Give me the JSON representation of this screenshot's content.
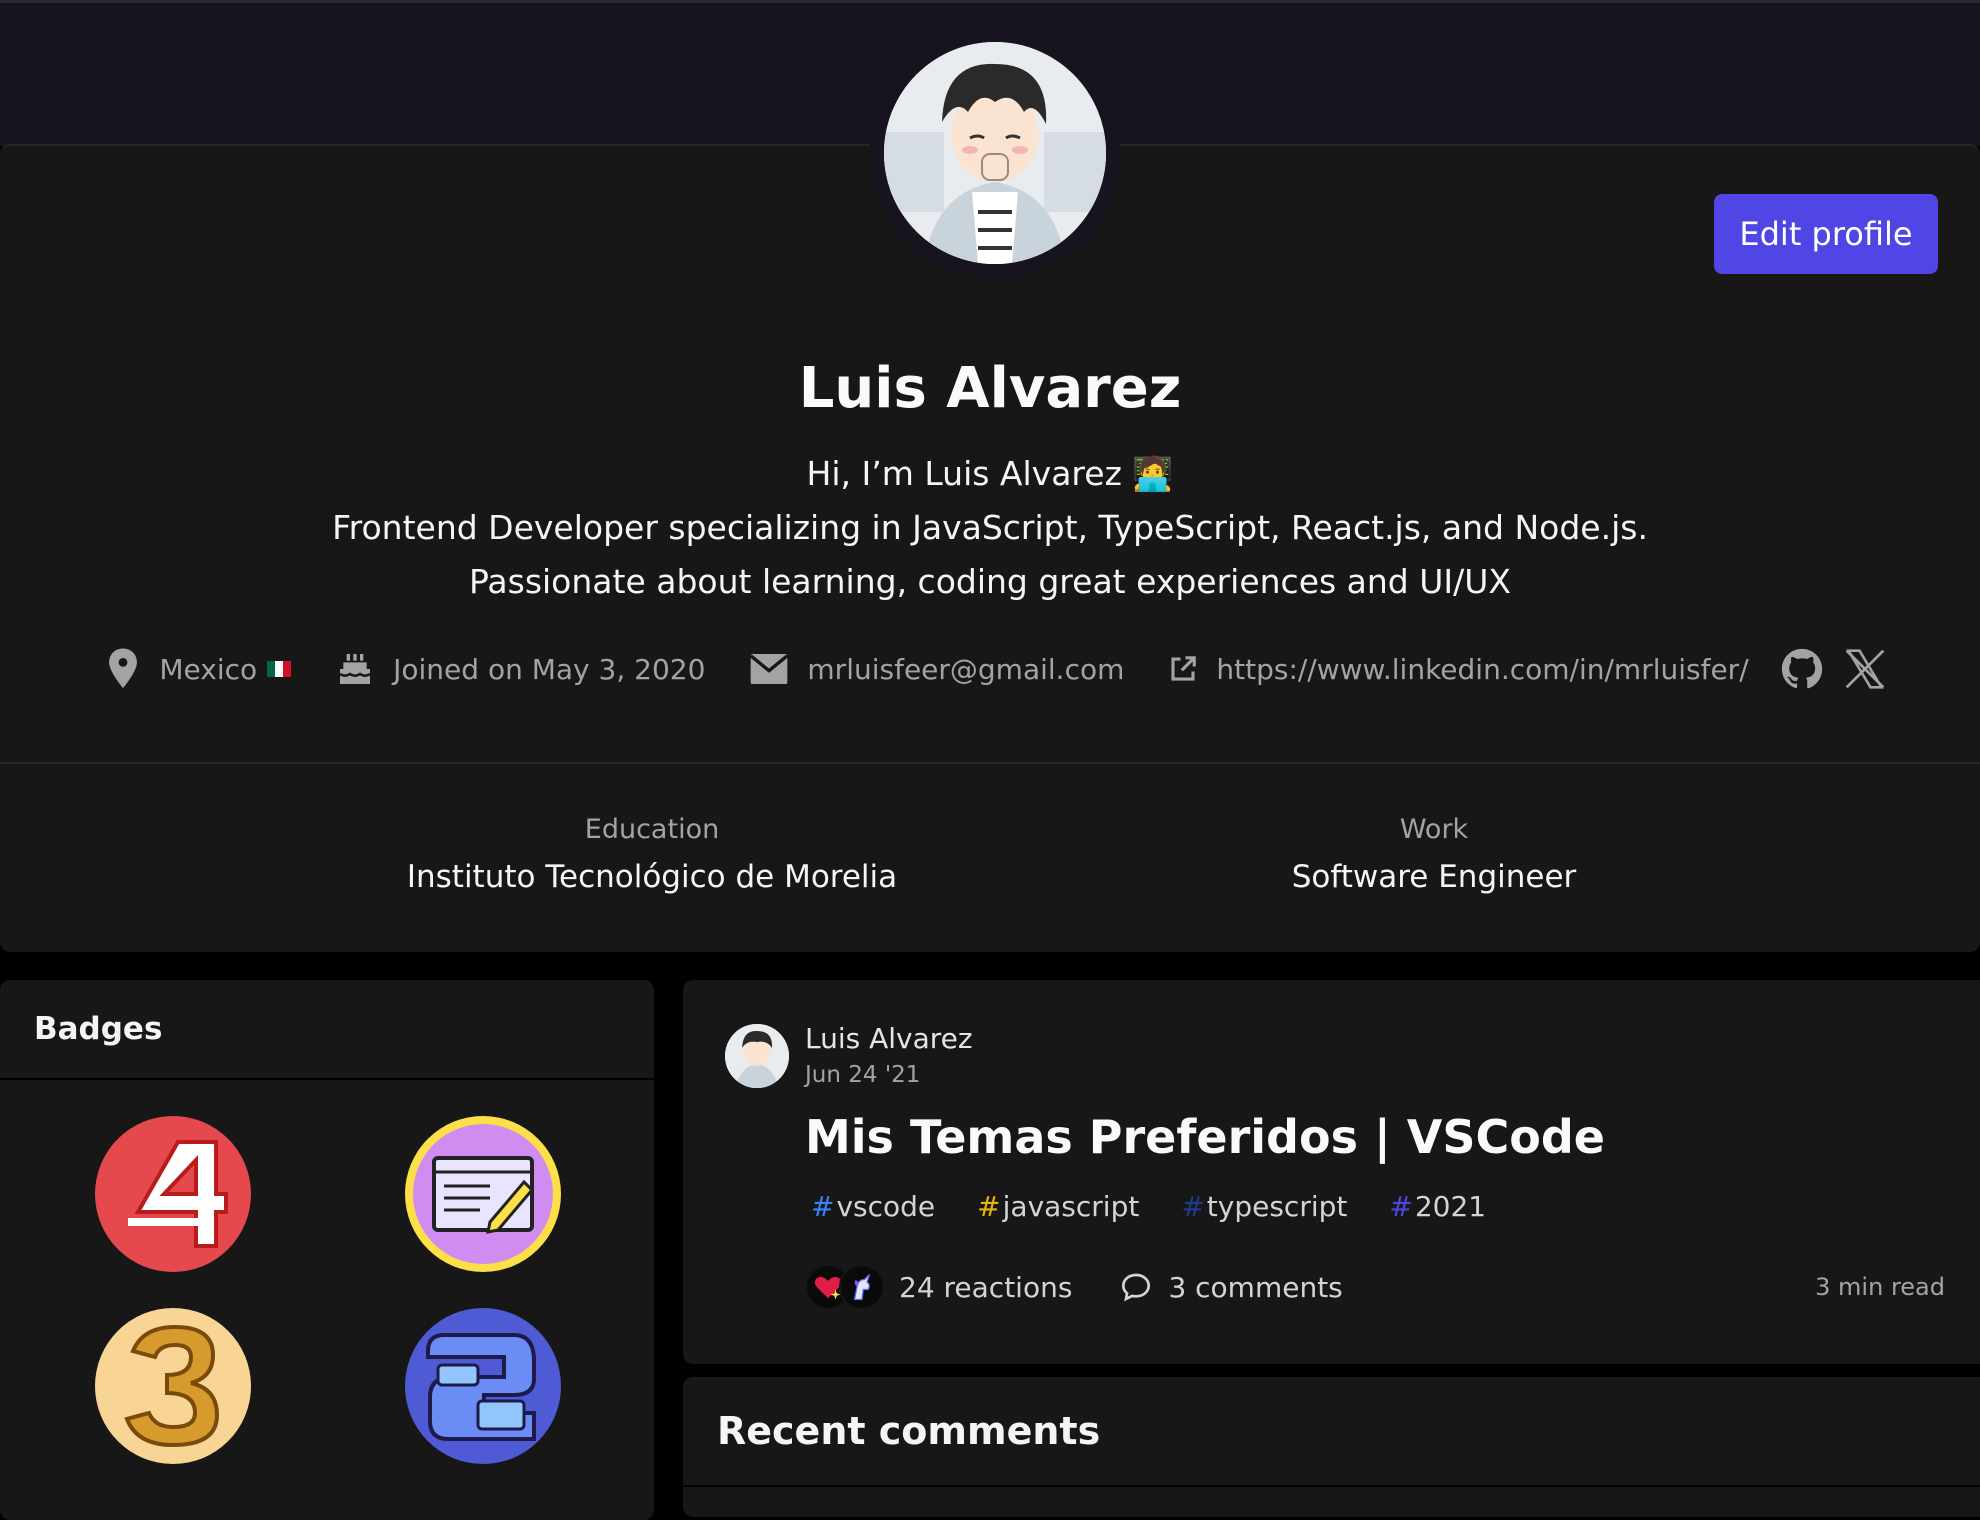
{
  "profile": {
    "name": "Luis Alvarez",
    "edit_label": "Edit profile",
    "bio": [
      "Hi, I’m Luis Alvarez 🧑‍💻",
      "Frontend Developer specializing in JavaScript, TypeScript, React.js, and Node.js.",
      "Passionate about learning, coding great experiences and UI/UX"
    ],
    "location": "Mexico",
    "joined": "Joined on May 3, 2020",
    "email": "mrluisfeer@gmail.com",
    "website": "https://www.linkedin.com/in/mrluisfer/",
    "education_label": "Education",
    "education_value": "Instituto Tecnológico de Morelia",
    "work_label": "Work",
    "work_value": "Software Engineer"
  },
  "badges": {
    "title": "Badges",
    "items": [
      {
        "icon": "four-year-badge-icon",
        "color": "#e5484d"
      },
      {
        "icon": "writing-debut-badge-icon",
        "color": "#c77dff"
      },
      {
        "icon": "three-year-badge-icon",
        "color": "#d4952e"
      },
      {
        "icon": "two-year-badge-icon",
        "color": "#4f5bd5"
      }
    ]
  },
  "post": {
    "author": "Luis Alvarez",
    "date": "Jun 24 '21",
    "title": "Mis Temas Preferidos | VSCode",
    "tags": [
      {
        "name": "vscode",
        "hash_color": "#3b82f6"
      },
      {
        "name": "javascript",
        "hash_color": "#eab308"
      },
      {
        "name": "typescript",
        "hash_color": "#1e3a8a"
      },
      {
        "name": "2021",
        "hash_color": "#4f46e5"
      }
    ],
    "reactions": "24 reactions",
    "comments": "3 comments",
    "read_time": "3 min read"
  },
  "recent_comments": {
    "title": "Recent comments"
  },
  "colors": {
    "accent": "#4f46e5",
    "card": "#171717",
    "banner": "#17141f"
  }
}
